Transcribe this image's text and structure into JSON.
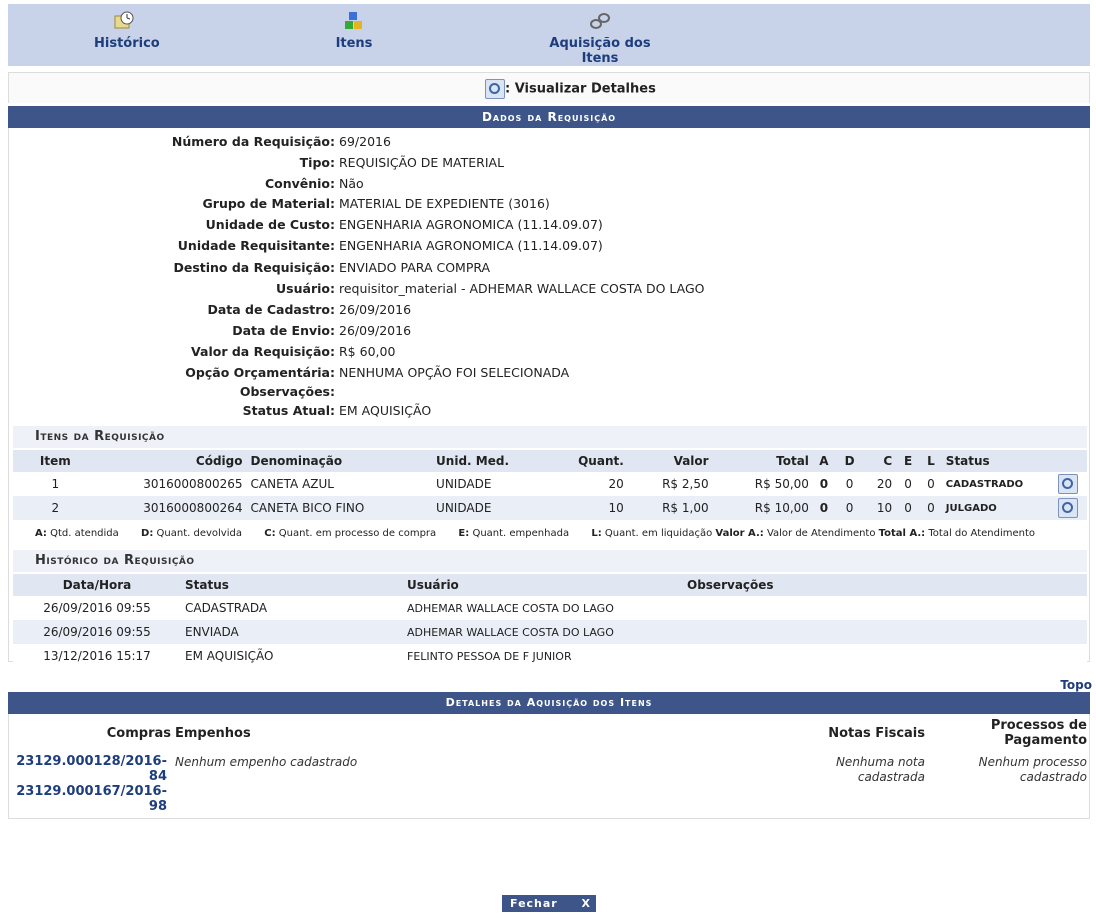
{
  "tabs": [
    {
      "label": "Histórico",
      "icon": "clock-icon"
    },
    {
      "label": "Itens",
      "icon": "blocks-icon"
    },
    {
      "label": "Aquisição dos Itens",
      "icon": "handcuff-icon"
    }
  ],
  "visualizar": ": Visualizar Detalhes",
  "dados": {
    "title": "Dados da Requisição",
    "fields": [
      {
        "label": "Número da Requisição:",
        "value": "69/2016"
      },
      {
        "label": "Tipo:",
        "value": "REQUISIÇÃO DE MATERIAL"
      },
      {
        "label": "Convênio:",
        "value": "Não"
      },
      {
        "label": "Grupo de Material:",
        "value": "MATERIAL DE EXPEDIENTE (3016)"
      },
      {
        "label": "Unidade de Custo:",
        "value": "ENGENHARIA AGRONOMICA (11.14.09.07)"
      },
      {
        "label": "Unidade Requisitante:",
        "value": "ENGENHARIA AGRONOMICA (11.14.09.07)"
      },
      {
        "label": "Destino da Requisição:",
        "value": "ENVIADO PARA COMPRA"
      },
      {
        "label": "Usuário:",
        "value": "requisitor_material - ADHEMAR WALLACE COSTA DO LAGO"
      },
      {
        "label": "Data de Cadastro:",
        "value": "26/09/2016"
      },
      {
        "label": "Data de Envio:",
        "value": "26/09/2016"
      },
      {
        "label": "Valor da Requisição:",
        "value": "R$ 60,00"
      },
      {
        "label": "Opção Orçamentária:",
        "value": "NENHUMA OPÇÃO FOI SELECIONADA"
      },
      {
        "label": "Observações:",
        "value": ""
      },
      {
        "label": "Status Atual:",
        "value": "EM AQUISIÇÃO"
      }
    ]
  },
  "itens": {
    "title": "Itens da Requisição",
    "headers": {
      "item": "Item",
      "codigo": "Código",
      "denom": "Denominação",
      "unid": "Unid. Med.",
      "quant": "Quant.",
      "valor": "Valor",
      "total": "Total",
      "a": "A",
      "d": "D",
      "c": "C",
      "e": "E",
      "l": "L",
      "status": "Status"
    },
    "rows": [
      {
        "item": "1",
        "codigo": "3016000800265",
        "denom": "CANETA AZUL",
        "unid": "UNIDADE",
        "quant": "20",
        "valor": "R$ 2,50",
        "total": "R$ 50,00",
        "a": "0",
        "d": "0",
        "c": "20",
        "e": "0",
        "l": "0",
        "status": "CADASTRADO"
      },
      {
        "item": "2",
        "codigo": "3016000800264",
        "denom": "CANETA BICO FINO",
        "unid": "UNIDADE",
        "quant": "10",
        "valor": "R$ 1,00",
        "total": "R$ 10,00",
        "a": "0",
        "d": "0",
        "c": "10",
        "e": "0",
        "l": "0",
        "status": "JULGADO"
      }
    ],
    "legend": [
      {
        "k": "A:",
        "v": "Qtd. atendida"
      },
      {
        "k": "D:",
        "v": "Quant. devolvida"
      },
      {
        "k": "C:",
        "v": "Quant. em processo de compra"
      },
      {
        "k": "E:",
        "v": "Quant. empenhada"
      },
      {
        "k": "L:",
        "v": "Quant. em liquidação"
      },
      {
        "k": "Valor A.:",
        "v": "Valor de Atendimento"
      },
      {
        "k": "Total A.:",
        "v": "Total do Atendimento"
      }
    ]
  },
  "historico": {
    "title": "Histórico da Requisição",
    "headers": {
      "data": "Data/Hora",
      "status": "Status",
      "usuario": "Usuário",
      "obs": "Observações"
    },
    "rows": [
      {
        "data": "26/09/2016 09:55",
        "status": "CADASTRADA",
        "usuario": "ADHEMAR WALLACE COSTA DO LAGO"
      },
      {
        "data": "26/09/2016 09:55",
        "status": "ENVIADA",
        "usuario": "ADHEMAR WALLACE COSTA DO LAGO"
      },
      {
        "data": "13/12/2016 15:17",
        "status": "EM AQUISIÇÃO",
        "usuario": "FELINTO PESSOA DE F JUNIOR"
      }
    ]
  },
  "topo": "Topo",
  "aquisicao": {
    "title": "Detalhes da Aquisição dos Itens",
    "headers": {
      "compras": "Compras",
      "empenhos": "Empenhos",
      "notas": "Notas Fiscais",
      "processos_1": "Processos de",
      "processos_2": "Pagamento"
    },
    "compras": [
      "23129.000128/2016-",
      "84",
      "23129.000167/2016-",
      "98"
    ],
    "empenhos": "Nenhum empenho cadastrado",
    "notas_1": "Nenhuma nota",
    "notas_2": "cadastrada",
    "processos_1": "Nenhum processo",
    "processos_2": "cadastrado"
  },
  "fechar": {
    "label": "Fechar",
    "x": "X"
  }
}
